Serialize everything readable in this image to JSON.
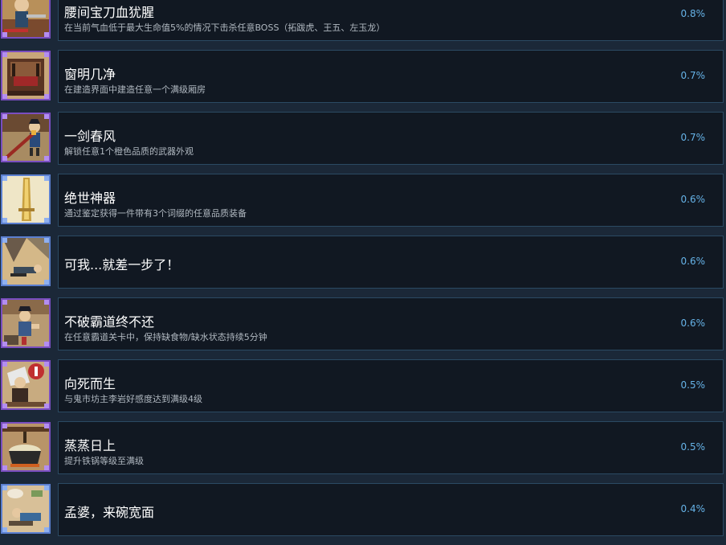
{
  "achievements": [
    {
      "title": "腰间宝刀血犹腥",
      "desc": "在当前气血低于最大生命值5%的情况下击杀任意BOSS（拓跋虎、王五、左玉龙）",
      "pct": "0.8%",
      "icon": "warrior-portrait-icon"
    },
    {
      "title": "窗明几净",
      "desc": "在建造界面中建造任意一个满级厢房",
      "pct": "0.7%",
      "icon": "furnished-room-icon"
    },
    {
      "title": "一剑春风",
      "desc": "解锁任意1个橙色品质的武器外观",
      "pct": "0.7%",
      "icon": "swordsman-icon"
    },
    {
      "title": "绝世神器",
      "desc": "通过鉴定获得一件带有3个词缀的任意品质装备",
      "pct": "0.6%",
      "icon": "golden-artifact-icon"
    },
    {
      "title": "可我...就差一步了！",
      "desc": "",
      "pct": "0.6%",
      "icon": "fallen-hero-icon"
    },
    {
      "title": "不破霸道终不还",
      "desc": "在任意霸道关卡中，保持缺食物/缺水状态持续5分钟",
      "pct": "0.6%",
      "icon": "wanderer-icon"
    },
    {
      "title": "向死而生",
      "desc": "与鬼市坊主李岩好感度达到满级4级",
      "pct": "0.5%",
      "icon": "ghost-market-master-icon"
    },
    {
      "title": "蒸蒸日上",
      "desc": "提升铁锅等级至满级",
      "pct": "0.5%",
      "icon": "iron-pot-icon"
    },
    {
      "title": "孟婆，来碗宽面",
      "desc": "",
      "pct": "0.4%",
      "icon": "resting-traveler-icon"
    }
  ],
  "colors": {
    "background": "#1b2838",
    "card": "#111822",
    "card_border": "#2b4a63",
    "percent": "#66b3e8",
    "icon_frame_purple": "#7a4ec0",
    "icon_frame_blue": "#5b7fd0"
  }
}
